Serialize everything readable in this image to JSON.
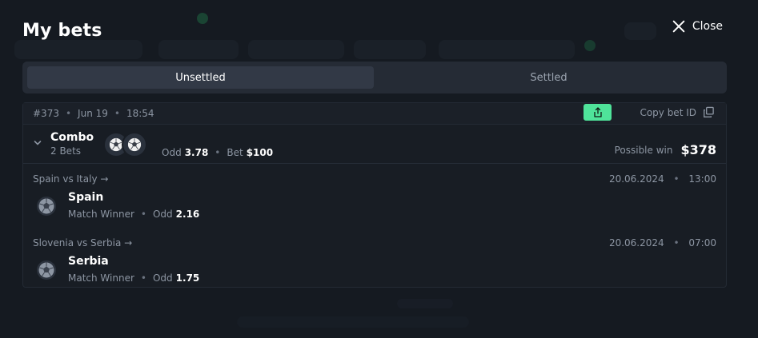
{
  "header": {
    "title": "My bets",
    "close_label": "Close"
  },
  "tabs": [
    {
      "label": "Unsettled",
      "active": true
    },
    {
      "label": "Settled",
      "active": false
    }
  ],
  "bet": {
    "id": "#373",
    "date": "Jun 19",
    "time": "18:54",
    "copy_label": "Copy bet ID",
    "type": "Combo",
    "count": "2 Bets",
    "odd_label": "Odd",
    "odd": "3.78",
    "bet_label": "Bet",
    "stake": "$100",
    "win_label": "Possible win",
    "win": "$378",
    "legs": [
      {
        "match": "Spain vs Italy →",
        "date": "20.06.2024",
        "time": "13:00",
        "team": "Spain",
        "market": "Match Winner",
        "odd_label": "Odd",
        "odd": "2.16"
      },
      {
        "match": "Slovenia vs Serbia →",
        "date": "20.06.2024",
        "time": "07:00",
        "team": "Serbia",
        "market": "Match Winner",
        "odd_label": "Odd",
        "odd": "1.75"
      }
    ]
  },
  "colors": {
    "accent": "#4fe39a",
    "background": "#151a21",
    "card": "#181d24",
    "muted": "#8d96a3"
  },
  "icons": [
    "close-icon",
    "share-icon",
    "copy-icon",
    "chevron-down-icon",
    "soccer-ball-icon"
  ]
}
